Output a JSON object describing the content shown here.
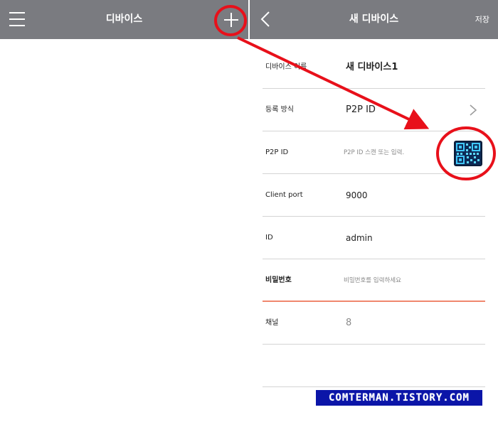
{
  "left_screen": {
    "header": {
      "title": "디바이스",
      "menu_icon": "hamburger-menu-icon",
      "add_icon": "plus-icon"
    }
  },
  "right_screen": {
    "header": {
      "title": "새 디바이스",
      "back_icon": "chevron-left-icon",
      "save_label": "저장"
    },
    "form": {
      "device_name_label": "디바이스 이름",
      "device_name_value": "새 디바이스1",
      "registration_label": "등록 방식",
      "registration_value": "P2P ID",
      "p2p_label": "P2P ID",
      "p2p_placeholder": "P2P ID 스캔 또는 입력.",
      "qr_icon": "qr-code-icon",
      "client_port_label": "Client port",
      "client_port_value": "9000",
      "id_label": "ID",
      "id_value": "admin",
      "password_label": "비밀번호",
      "password_placeholder": "비밀번호를  입력하세요",
      "channel_label": "채널",
      "channel_value": "8"
    }
  },
  "watermark": "COMTERMAN.TISTORY.COM",
  "colors": {
    "header_bg": "#7a7b80",
    "annotation_red": "#e8101a",
    "active_underline": "#f0876e",
    "watermark_bg": "#0b15a8"
  }
}
